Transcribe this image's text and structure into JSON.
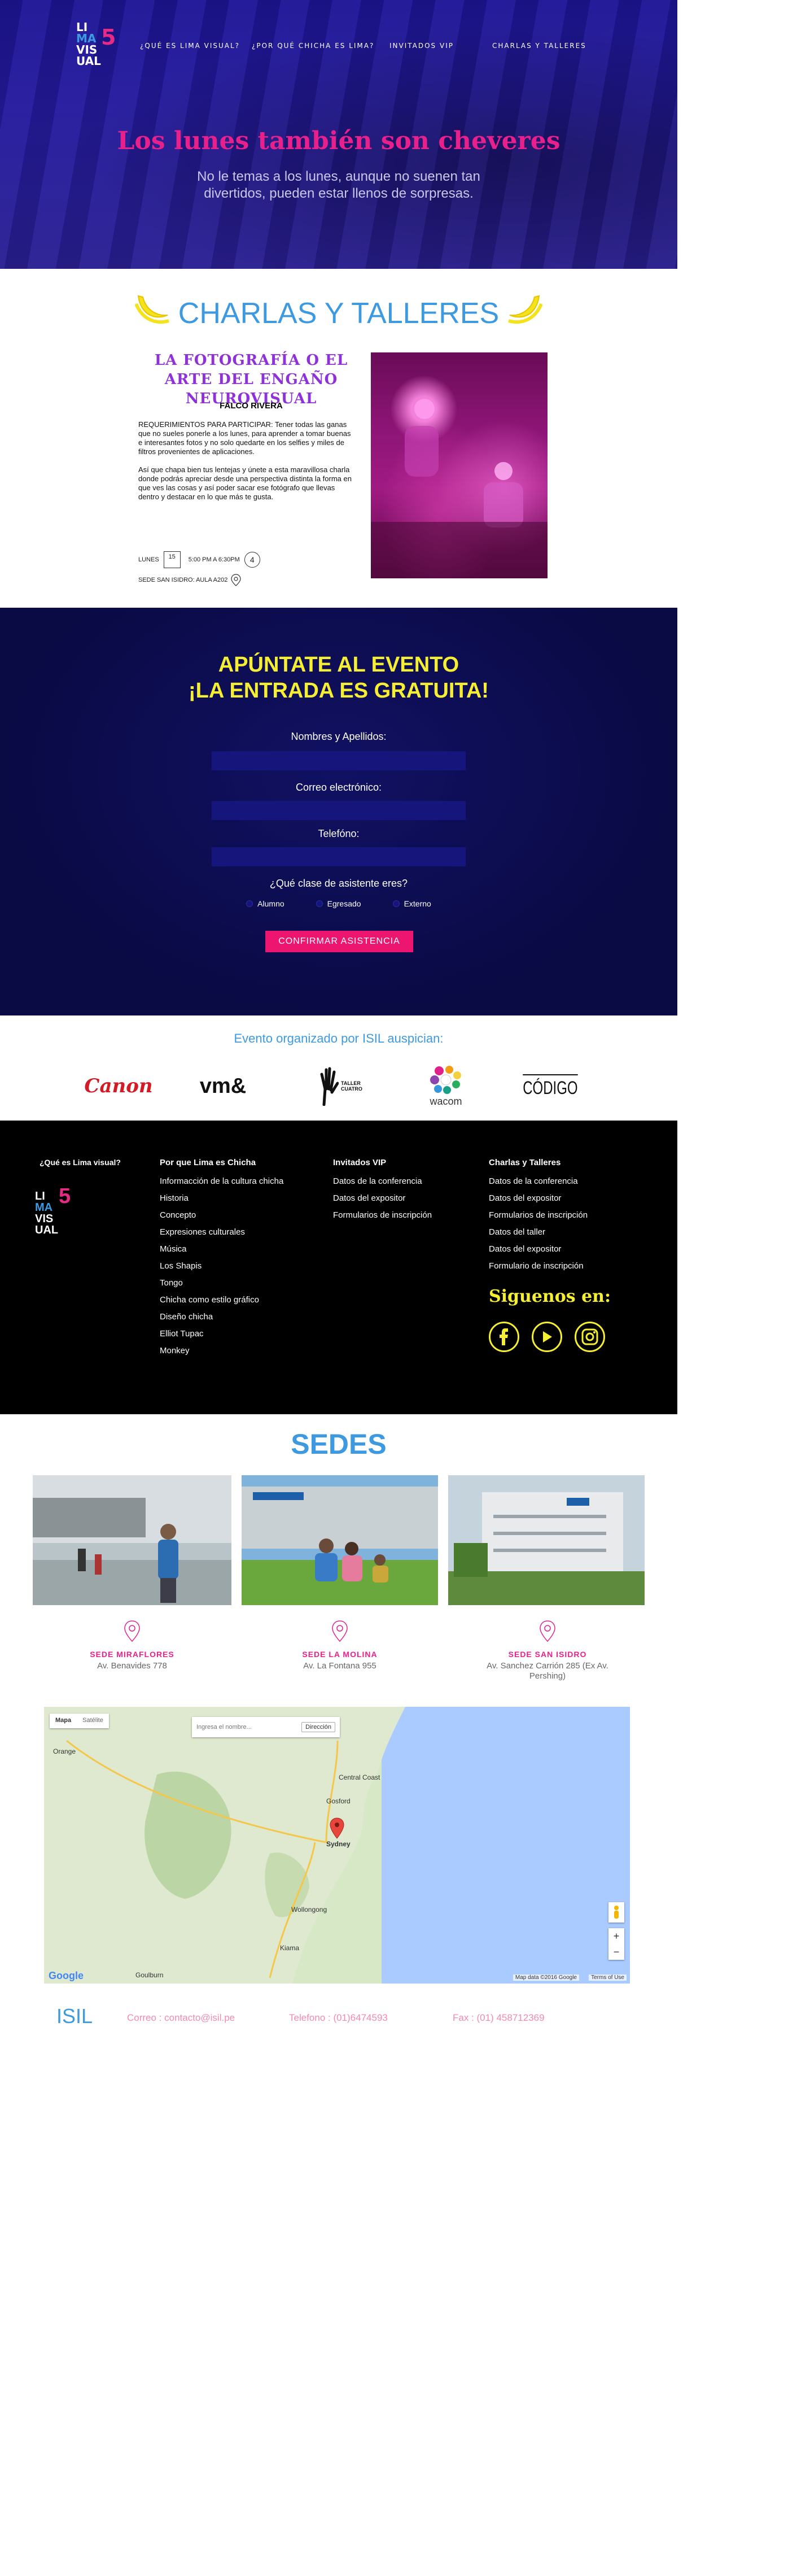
{
  "logo": {
    "lines": [
      "LI",
      "MA",
      "VIS",
      "UAL"
    ],
    "number": "5"
  },
  "nav": [
    {
      "label": "¿QUÉ ES LIMA VISUAL?"
    },
    {
      "label": "¿POR QUÉ CHICHA ES LIMA?"
    },
    {
      "label": "INVITADOS VIP"
    },
    {
      "label": "CHARLAS Y TALLERES"
    }
  ],
  "hero": {
    "title": "Los lunes también son cheveres",
    "subtitle": "No le temas a los lunes, aunque no suenen tan divertidos, pueden estar llenos de sorpresas."
  },
  "charlas": {
    "title": "CHARLAS Y TALLERES",
    "event_title": "LA FOTOGRAFÍA O EL ARTE DEL ENGAÑO NEUROVISUAL",
    "speaker": "FALCO RIVERA",
    "requirements": "REQUERIMIENTOS PARA PARTICIPAR: Tener todas las ganas que no sueles ponerle a los lunes, para aprender a tomar buenas e interesantes fotos y no solo quedarte en los selfies y  miles de filtros provenientes de aplicaciones.",
    "description": "Así que chapa bien tus lentejas y únete a esta maravillosa charla donde podrás apreciar desde una perspectiva distinta la forma en que ves las cosas y así poder sacar ese fotógrafo que llevas dentro y destacar en lo que más te gusta.",
    "day": "LUNES",
    "date_num": "15",
    "time": "5:00 PM A 6:30PM",
    "arrow": "4",
    "venue": "SEDE SAN ISIDRO: AULA A202"
  },
  "form": {
    "title_line1": "APÚNTATE AL EVENTO",
    "title_line2": "¡LA ENTRADA ES GRATUITA!",
    "name_label": "Nombres y Apellidos:",
    "email_label": "Correo electrónico:",
    "phone_label": "Telefóno:",
    "type_label": "¿Qué clase de asistente eres?",
    "options": [
      "Alumno",
      "Egresado",
      "Externo"
    ],
    "submit": "CONFIRMAR ASISTENCIA"
  },
  "sponsors": {
    "title": "Evento organizado por ISIL auspician:",
    "logos": [
      "Canon",
      "vm&",
      "TALLER CUATRO",
      "wacom",
      "CÓDIGO"
    ]
  },
  "footer": {
    "col1_title": "¿Qué es Lima visual?",
    "col2_title": "Por que Lima es Chicha",
    "col2_items": [
      "Informacción de la cultura chicha",
      "Historia",
      "Concepto",
      "Expresiones culturales",
      "Música",
      "Los Shapis",
      "Tongo",
      "Chicha como estilo gráfico",
      "Diseño chicha",
      "Elliot Tupac",
      "Monkey"
    ],
    "col3_title": "Invitados VIP",
    "col3_items": [
      "Datos de la conferencia",
      "Datos del expositor",
      "Formularios de inscripción"
    ],
    "col4_title": "Charlas y Talleres",
    "col4_items": [
      "Datos de la conferencia",
      "Datos del expositor",
      "Formularios de inscripción",
      "Datos del taller",
      "Datos del expositor",
      "Formulario de inscripción"
    ],
    "follow": "Siguenos en:",
    "social": [
      "facebook-icon",
      "youtube-icon",
      "instagram-icon"
    ]
  },
  "sedes": {
    "title": "SEDES",
    "items": [
      {
        "name": "SEDE MIRAFLORES",
        "address": "Av. Benavides 778"
      },
      {
        "name": "SEDE LA MOLINA",
        "address": "Av. La Fontana 955"
      },
      {
        "name": "SEDE SAN ISIDRO",
        "address": "Av. Sanchez Carrión 285 (Ex Av. Pershing)"
      }
    ],
    "map": {
      "tab_map": "Mapa",
      "tab_sat": "Satélite",
      "search_placeholder": "Ingresa el nombre...",
      "search_button": "Dirección",
      "cities": [
        "Central Coast",
        "Gosford",
        "Sydney",
        "Wollongong",
        "Kiama",
        "Goulburn",
        "Orange"
      ],
      "footer_text": "Map data ©2016 Google",
      "terms": "Terms of Use",
      "google": "Google",
      "zoom_in": "+",
      "zoom_out": "−"
    }
  },
  "contact": {
    "brand": "ISIL",
    "email": "Correo : contacto@isil.pe",
    "phone": "Telefono : (01)6474593",
    "fax": "Fax : (01) 458712369"
  },
  "colors": {
    "brand_blue": "#3d9ae0",
    "hero_bg": "#1d1596",
    "pink": "#e7208c",
    "yellow": "#f5ee32",
    "form_bg": "#0c0c4a"
  }
}
